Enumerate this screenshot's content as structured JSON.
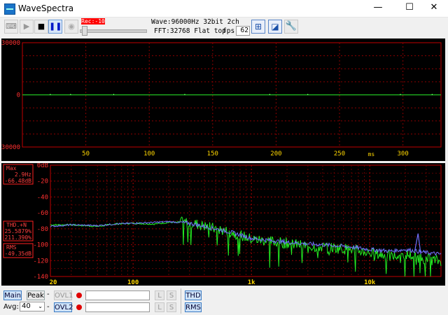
{
  "window": {
    "title": "WaveSpectra",
    "minimize": "—",
    "maximize": "☐",
    "close": "✕"
  },
  "toolbar": {
    "record_indicator": "Rec:-10",
    "wave_info": "Wave:96000Hz 32bit 2ch",
    "fft_info": "FFT:32768 Flat top",
    "fps_label": "fps:",
    "fps_value": "62"
  },
  "wave_view": {
    "ylabels": [
      "30000",
      "0",
      "-30000"
    ],
    "xlabels": [
      "50",
      "100",
      "150",
      "200",
      "250",
      "300"
    ],
    "xunit": "ms"
  },
  "spectrum_view": {
    "ylabels": [
      "0dB",
      "-20",
      "-40",
      "-60",
      "-80",
      "-100",
      "-120",
      "-140"
    ],
    "xlabels": [
      "20",
      "100",
      "1k",
      "10k"
    ],
    "max_title": "Max",
    "max_freq": "2.9Hz",
    "max_level": "-66.48dB",
    "thd_title": "THD.+N",
    "thd_value1": "25.5879%",
    "thd_value2": "211.390%",
    "rms_title": "RMS",
    "rms_value": "-49.35dB"
  },
  "chart_data": [
    {
      "type": "line",
      "title": "",
      "xlabel": "ms",
      "ylabel": "",
      "xlim": [
        0,
        330
      ],
      "ylim": [
        -30000,
        30000
      ],
      "series": [
        {
          "values": [
            0,
            0,
            0,
            0,
            0,
            0,
            0,
            0,
            0,
            0
          ]
        }
      ]
    },
    {
      "type": "line",
      "title": "",
      "xlabel": "",
      "ylabel": "dB",
      "xlim": [
        20,
        40000
      ],
      "ylim": [
        -140,
        0
      ],
      "xscale": "log",
      "x": [
        20,
        30,
        50,
        70,
        100,
        150,
        200,
        300,
        500,
        700,
        1000,
        2000,
        3000,
        5000,
        7000,
        10000,
        15000,
        20000,
        30000,
        40000
      ],
      "series": [
        {
          "values": [
            -75,
            -75,
            -77,
            -74,
            -73,
            -74,
            -72,
            -72,
            -80,
            -85,
            -93,
            -98,
            -102,
            -104,
            -106,
            -110,
            -115,
            -112,
            -118,
            -121
          ]
        },
        {
          "values": [
            -77,
            -75,
            -76,
            -74,
            -73,
            -72,
            -71,
            -73,
            -80,
            -85,
            -92,
            -97,
            -99,
            -101,
            -103,
            -106,
            -108,
            -106,
            -110,
            -112
          ]
        }
      ]
    }
  ],
  "bottom": {
    "main_label": "Main",
    "peak_label": "Peak",
    "ovl1_label": "OVL1",
    "ovl2_label": "OVL2",
    "l_label": "L",
    "s_label": "S",
    "avg_label": "Avg:",
    "avg_value": "40",
    "thd_label": "THD",
    "rms_label": "RMS",
    "dash": "-"
  }
}
